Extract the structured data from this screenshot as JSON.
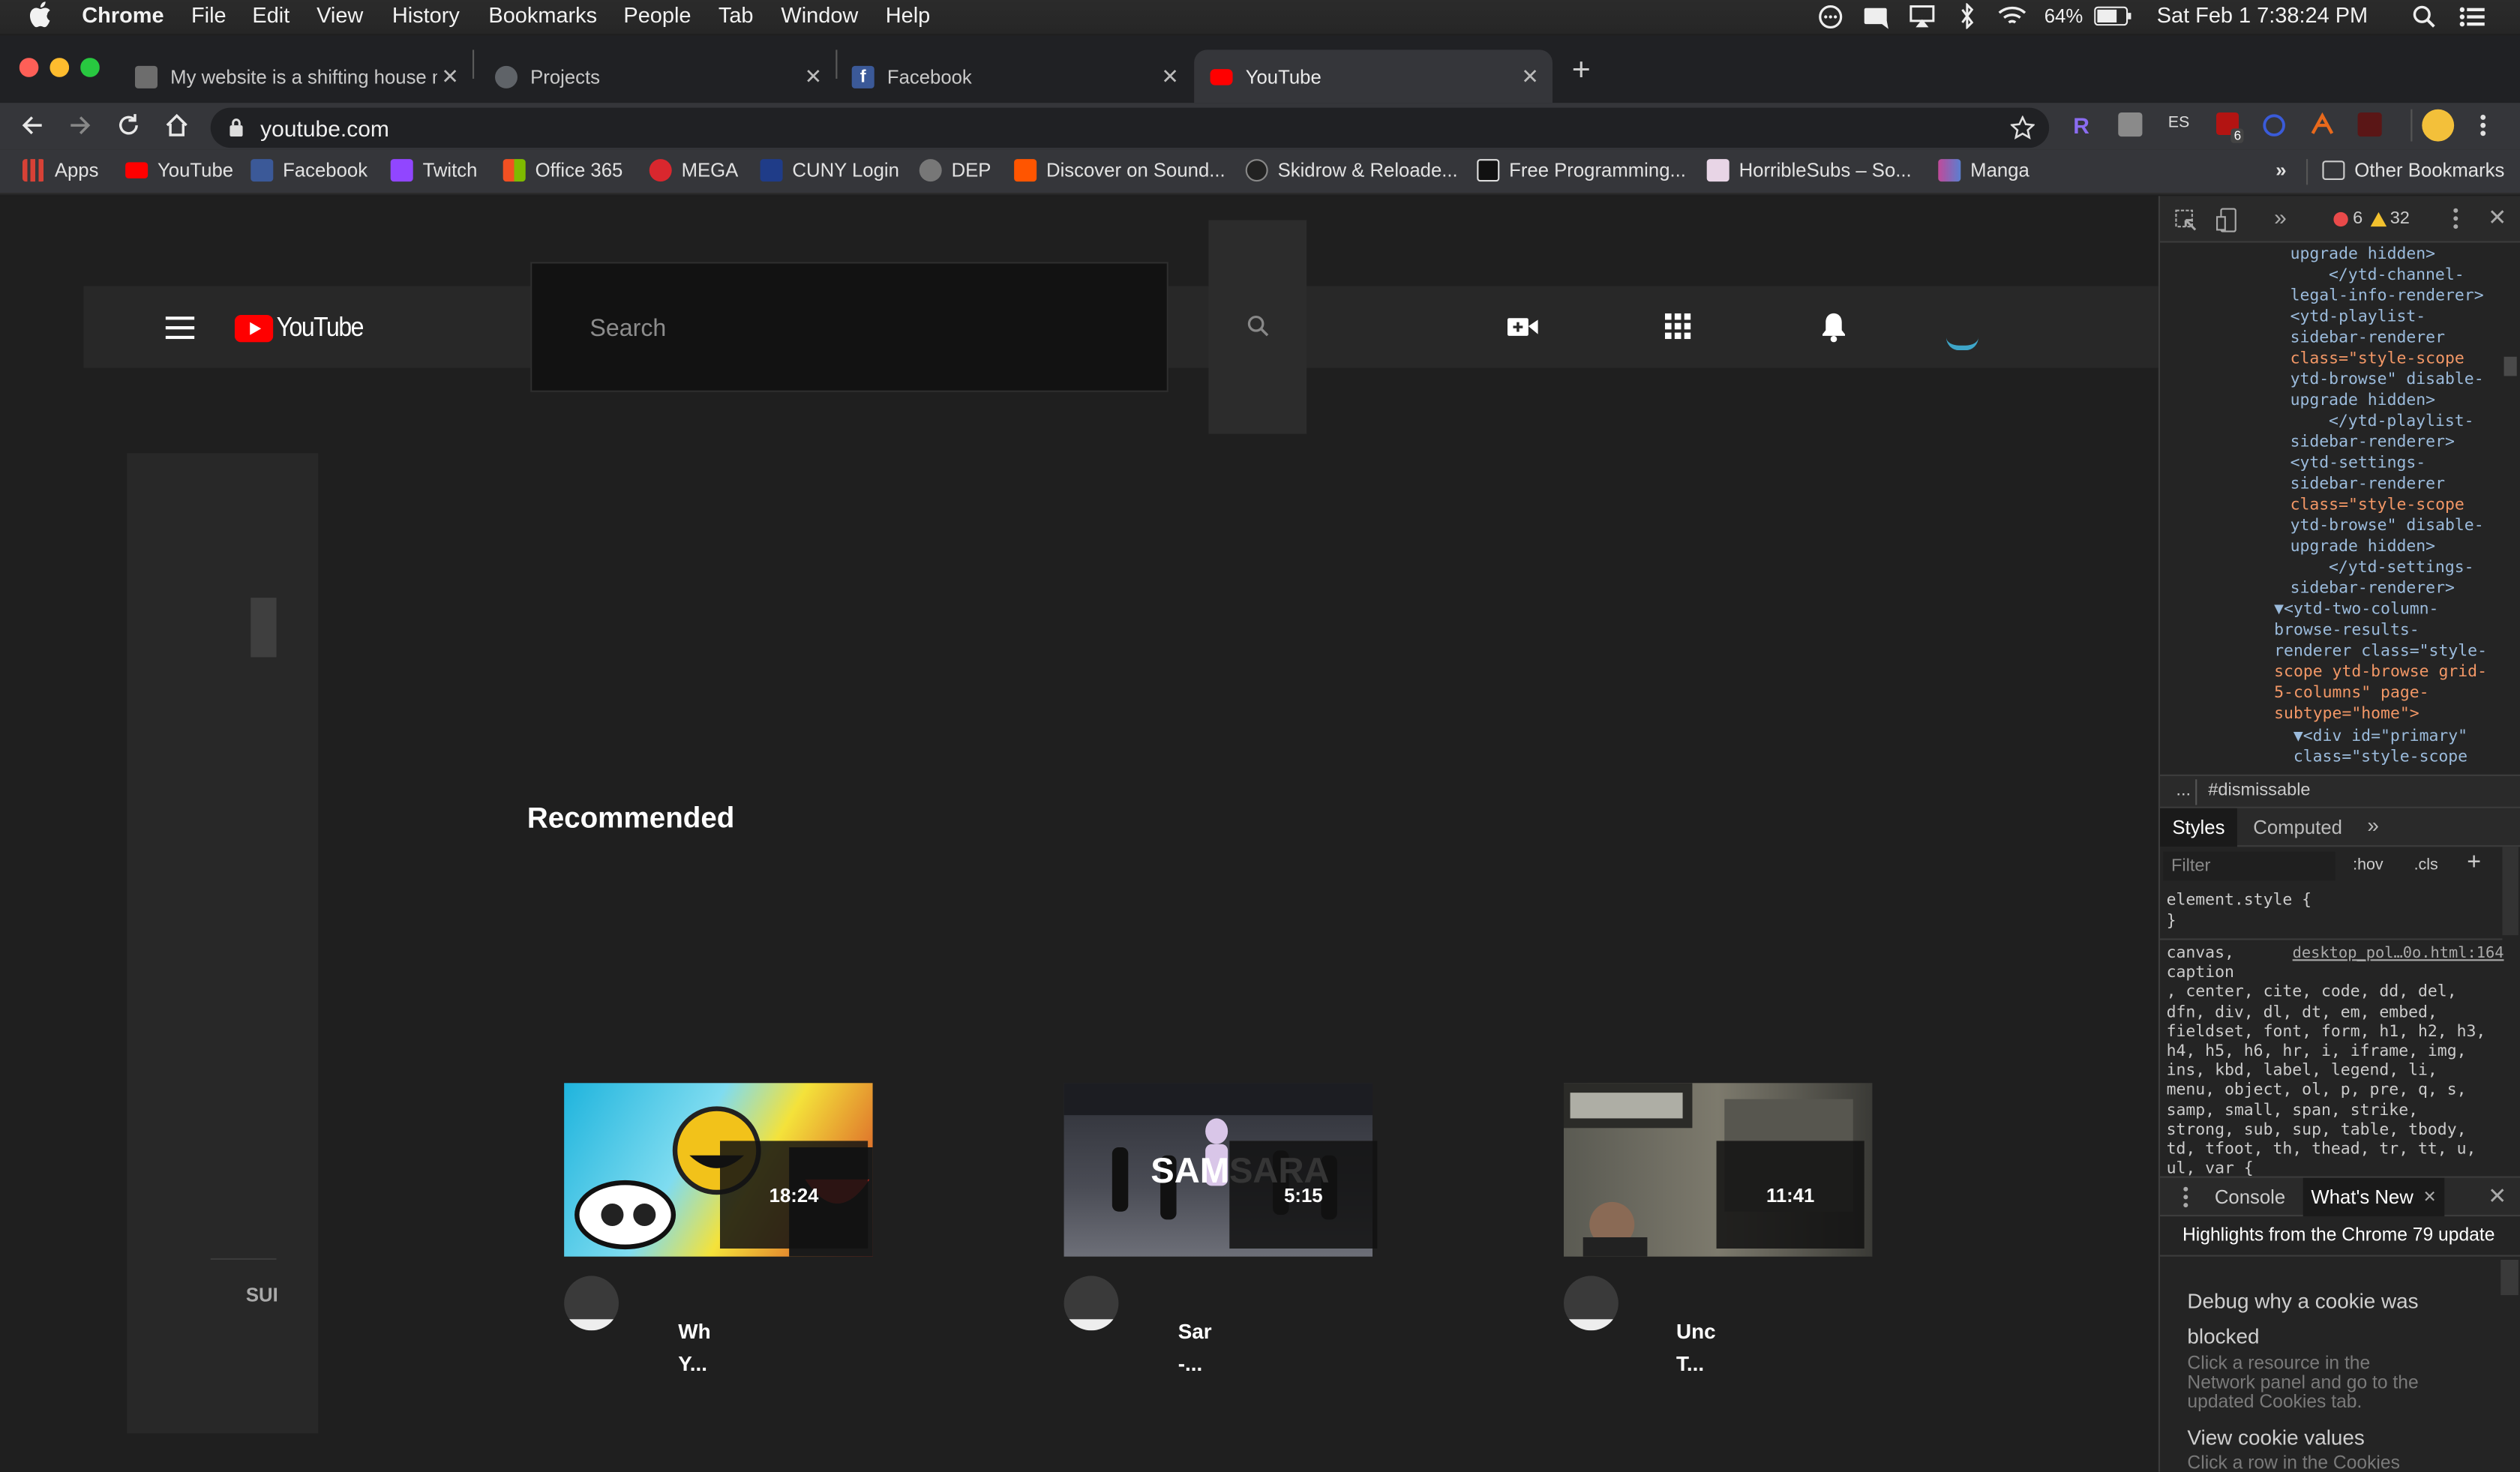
{
  "menubar": {
    "app": "Chrome",
    "items": [
      "File",
      "Edit",
      "View",
      "History",
      "Bookmarks",
      "People",
      "Tab",
      "Window",
      "Help"
    ],
    "battery": "64%",
    "datetime": "Sat Feb 1  7:38:24 PM"
  },
  "tabs": [
    {
      "title": "My website is a shifting house ne",
      "active": false
    },
    {
      "title": "Projects",
      "active": false
    },
    {
      "title": "Facebook",
      "active": false
    },
    {
      "title": "YouTube",
      "active": true
    }
  ],
  "omnibox": {
    "url": "youtube.com"
  },
  "extensions": {
    "es_label": "ES",
    "badge": "6"
  },
  "bookmarks": {
    "items": [
      "Apps",
      "YouTube",
      "Facebook",
      "Twitch",
      "Office 365",
      "MEGA",
      "CUNY Login",
      "DEP",
      "Discover on Sound...",
      "Skidrow & Reloade...",
      "Free Programming...",
      "HorribleSubs – So...",
      "Manga"
    ],
    "overflow": "»",
    "other": "Other Bookmarks"
  },
  "youtube": {
    "logo": "YouTube",
    "search_placeholder": "Search",
    "section": "Recommended",
    "guide_label": "SUI",
    "videos": [
      {
        "duration": "18:24",
        "title1": "Wh",
        "title2": "Y..."
      },
      {
        "duration": "5:15",
        "title1": "Sar",
        "title2": "-..."
      },
      {
        "duration": "11:41",
        "title1": "Unc",
        "title2": "T..."
      }
    ],
    "thumb2_overlay": "SAMSARA"
  },
  "devtools": {
    "errors": "6",
    "warnings": "32",
    "elements": [
      "upgrade hidden>",
      "</ytd-channel-",
      "legal-info-renderer>",
      "<ytd-playlist-",
      "sidebar-renderer",
      "class=\"style-scope",
      "ytd-browse\" disable-",
      "upgrade hidden>",
      "</ytd-playlist-",
      "sidebar-renderer>",
      "<ytd-settings-",
      "sidebar-renderer",
      "class=\"style-scope",
      "ytd-browse\" disable-",
      "upgrade hidden>",
      "</ytd-settings-",
      "sidebar-renderer>",
      "▼<ytd-two-column-",
      "browse-results-",
      "renderer class=\"style-",
      "scope ytd-browse grid-",
      "5-columns\" page-",
      "subtype=\"home\">",
      "▼<div id=\"primary\"",
      "class=\"style-scope"
    ],
    "breadcrumb_dots": "...",
    "breadcrumb": "#dismissable",
    "style_tabs": [
      "Styles",
      "Computed"
    ],
    "filter_placeholder": "Filter",
    "hov": ":hov",
    "cls": ".cls",
    "element_style": "element.style {",
    "close_brace": "}",
    "rule_selector": "canvas,",
    "rule_link": "desktop_pol…0o.html:164",
    "rule_lines": [
      "caption",
      ", center, cite, code, dd, del,",
      "dfn, div, dl, dt, em, embed,",
      "fieldset, font, form, h1, h2, h3,",
      "h4, h5, h6, hr, i, iframe, img,",
      "ins, kbd, label, legend, li,",
      "menu, object, ol, p, pre, q, s,",
      "samp, small, span, strike,",
      "strong, sub, sup, table, tbody,",
      "td, tfoot, th, thead, tr, tt, u,",
      "ul, var {"
    ],
    "drawer_tabs": [
      "Console",
      "What's New"
    ],
    "whatsnew_header": "Highlights from the Chrome 79 update",
    "items": [
      {
        "title1": "Debug why a cookie was",
        "title2": "blocked",
        "desc": [
          "Click a resource in the",
          "Network panel and go to the",
          "updated Cookies tab."
        ]
      },
      {
        "title1": "View cookie values",
        "desc": [
          "Click a row in the Cookies"
        ]
      }
    ]
  },
  "colors": {
    "youtube_red": "#ff0000",
    "facebook_blue": "#3b5998",
    "twitch_purple": "#9146ff",
    "devtools_tag": "#5db0d7",
    "devtools_attr_value": "#f29766"
  }
}
